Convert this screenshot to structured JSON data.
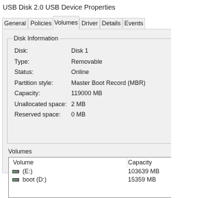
{
  "window": {
    "title": "USB Disk 2.0 USB Device Properties"
  },
  "tabs": [
    {
      "label": "General",
      "active": false
    },
    {
      "label": "Policies",
      "active": false
    },
    {
      "label": "Volumes",
      "active": true
    },
    {
      "label": "Driver",
      "active": false
    },
    {
      "label": "Details",
      "active": false
    },
    {
      "label": "Events",
      "active": false
    }
  ],
  "disk_info": {
    "group_title": "Disk Information",
    "rows": [
      {
        "label": "Disk:",
        "value": "Disk 1"
      },
      {
        "label": "Type:",
        "value": "Removable"
      },
      {
        "label": "Status:",
        "value": "Online"
      },
      {
        "label": "Partition style:",
        "value": "Master Boot Record (MBR)"
      },
      {
        "label": "Capacity:",
        "value": "119000 MB"
      },
      {
        "label": "Unallocated space:",
        "value": "2 MB"
      },
      {
        "label": "Reserved space:",
        "value": "0 MB"
      }
    ]
  },
  "volumes": {
    "section_title": "Volumes",
    "columns": {
      "volume": "Volume",
      "capacity": "Capacity"
    },
    "rows": [
      {
        "name": "(E:)",
        "capacity": "103639 MB",
        "icon": "drive-icon"
      },
      {
        "name": "boot (D:)",
        "capacity": "15359 MB",
        "icon": "drive-icon"
      }
    ]
  }
}
